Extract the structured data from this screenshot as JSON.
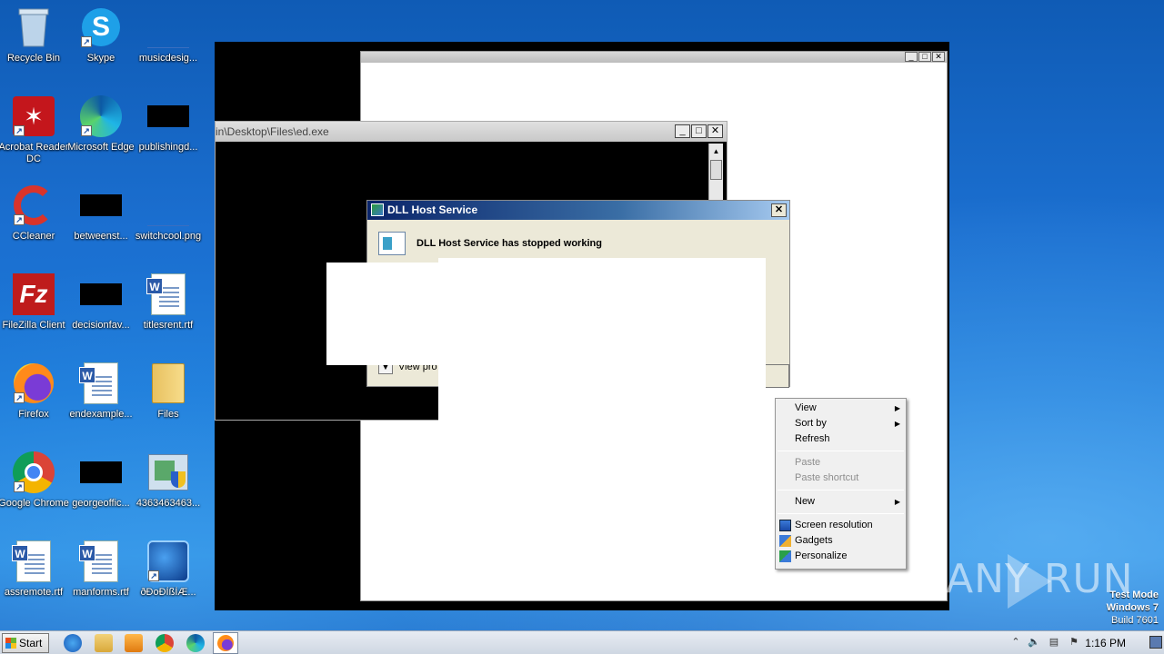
{
  "desktop": {
    "icons": [
      {
        "label": "Recycle Bin",
        "name": "recycle-bin-icon"
      },
      {
        "label": "Skype",
        "name": "skype-icon"
      },
      {
        "label": "musicdesig...",
        "name": "file-icon"
      },
      {
        "label": "Acrobat Reader DC",
        "name": "acrobat-icon"
      },
      {
        "label": "Microsoft Edge",
        "name": "edge-icon"
      },
      {
        "label": "publishingd...",
        "name": "file-icon"
      },
      {
        "label": "CCleaner",
        "name": "ccleaner-icon"
      },
      {
        "label": "betweenst...",
        "name": "file-icon"
      },
      {
        "label": "switchcool.png",
        "name": "image-file-icon"
      },
      {
        "label": "FileZilla Client",
        "name": "filezilla-icon"
      },
      {
        "label": "decisionfav...",
        "name": "file-icon"
      },
      {
        "label": "titlesrent.rtf",
        "name": "word-doc-icon"
      },
      {
        "label": "Firefox",
        "name": "firefox-icon"
      },
      {
        "label": "endexample...",
        "name": "word-doc-icon"
      },
      {
        "label": "Files",
        "name": "folder-icon"
      },
      {
        "label": "Google Chrome",
        "name": "chrome-icon"
      },
      {
        "label": "georgeoffic...",
        "name": "file-icon"
      },
      {
        "label": "4363463463...",
        "name": "installer-icon"
      },
      {
        "label": "assremote.rtf",
        "name": "word-doc-icon"
      },
      {
        "label": "manforms.rtf",
        "name": "word-doc-icon"
      },
      {
        "label": "ðÐoÐÌßÌÆ...",
        "name": "setup-icon"
      }
    ]
  },
  "console_window": {
    "title": "in\\Desktop\\Files\\ed.exe"
  },
  "dialog": {
    "title": "DLL Host Service",
    "message": "DLL Host Service has stopped working",
    "details_label": "View pro"
  },
  "context_menu": {
    "items": [
      {
        "label": "View",
        "submenu": true,
        "disabled": false
      },
      {
        "label": "Sort by",
        "submenu": true,
        "disabled": false
      },
      {
        "label": "Refresh",
        "submenu": false,
        "disabled": false
      },
      {
        "label": "Paste",
        "submenu": false,
        "disabled": true
      },
      {
        "label": "Paste shortcut",
        "submenu": false,
        "disabled": true
      },
      {
        "label": "New",
        "submenu": true,
        "disabled": false
      },
      {
        "label": "Screen resolution",
        "submenu": false,
        "disabled": false
      },
      {
        "label": "Gadgets",
        "submenu": false,
        "disabled": false
      },
      {
        "label": "Personalize",
        "submenu": false,
        "disabled": false
      }
    ]
  },
  "watermark": {
    "text": "ANY RUN"
  },
  "system_info": {
    "line1": "Test Mode",
    "line2": "Windows 7",
    "line3": "Build 7601"
  },
  "taskbar": {
    "start_label": "Start",
    "clock": "1:16 PM",
    "pinned": [
      "internet-explorer-icon",
      "explorer-icon",
      "media-player-icon",
      "chrome-icon",
      "edge-icon",
      "firefox-icon"
    ]
  },
  "colors": {
    "desktop_blue": "#1b6fd0",
    "dialog_title_start": "#0a246a",
    "menu_bg": "#f0f0f0"
  }
}
